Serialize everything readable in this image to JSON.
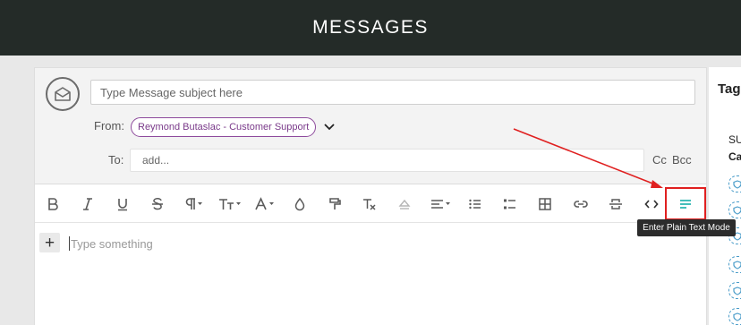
{
  "header": {
    "title": "MESSAGES"
  },
  "composer": {
    "subject_placeholder": "Type Message subject here",
    "subject_value": "",
    "from_label": "From:",
    "from_value": "Reymond Butaslac - Customer Support",
    "to_label": "To:",
    "to_placeholder": "add...",
    "to_value": "",
    "cc_label": "Cc",
    "bcc_label": "Bcc",
    "editor_placeholder": "Type something",
    "insert_button_label": "+"
  },
  "toolbar": {
    "buttons": [
      {
        "name": "bold",
        "icon": "bold-icon"
      },
      {
        "name": "italic",
        "icon": "italic-icon"
      },
      {
        "name": "underline",
        "icon": "underline-icon"
      },
      {
        "name": "strikethrough",
        "icon": "strikethrough-icon"
      },
      {
        "name": "paragraph",
        "icon": "paragraph-icon",
        "dropdown": true
      },
      {
        "name": "font-size",
        "icon": "font-size-icon",
        "dropdown": true
      },
      {
        "name": "font-color",
        "icon": "font-color-icon",
        "dropdown": true
      },
      {
        "name": "highlight",
        "icon": "droplet-icon"
      },
      {
        "name": "format-painter",
        "icon": "paint-roller-icon"
      },
      {
        "name": "clear-format",
        "icon": "clear-format-icon"
      },
      {
        "name": "superscript",
        "icon": "caret-up-icon"
      },
      {
        "name": "align",
        "icon": "align-icon",
        "dropdown": true
      },
      {
        "name": "bulleted-list",
        "icon": "bulleted-list-icon"
      },
      {
        "name": "checklist",
        "icon": "checklist-icon"
      },
      {
        "name": "table",
        "icon": "table-icon"
      },
      {
        "name": "link",
        "icon": "link-icon"
      },
      {
        "name": "horizontal-rule",
        "icon": "horizontal-rule-icon"
      },
      {
        "name": "code-view",
        "icon": "code-icon"
      },
      {
        "name": "plain-text-mode",
        "icon": "plain-text-icon",
        "active": true
      }
    ],
    "tooltip": "Enter Plain Text Mode"
  },
  "right_panel": {
    "title": "Tag",
    "line1": "SU",
    "line2": "Ca"
  },
  "colors": {
    "topbar": "#242b28",
    "chip_border": "#8d4a9c",
    "accent_teal": "#2bb5b0",
    "annotation_red": "#e02020"
  }
}
